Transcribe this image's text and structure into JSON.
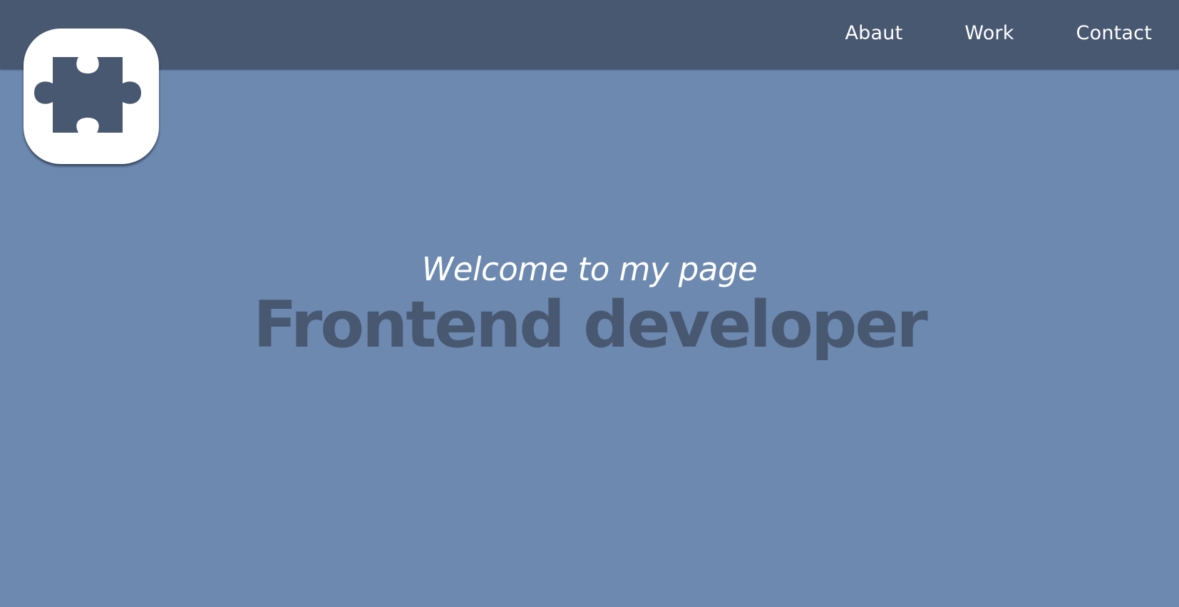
{
  "nav": {
    "items": [
      {
        "label": "Abaut"
      },
      {
        "label": "Work"
      },
      {
        "label": "Contact"
      }
    ]
  },
  "logo": {
    "icon": "puzzle-piece-icon"
  },
  "hero": {
    "subtitle": "Welcome to my page",
    "title": "Frontend developer"
  },
  "colors": {
    "background": "#6d89b0",
    "header": "#485871",
    "title": "#485871",
    "subtitle": "#ffffff",
    "logo_tile": "#ffffff"
  }
}
